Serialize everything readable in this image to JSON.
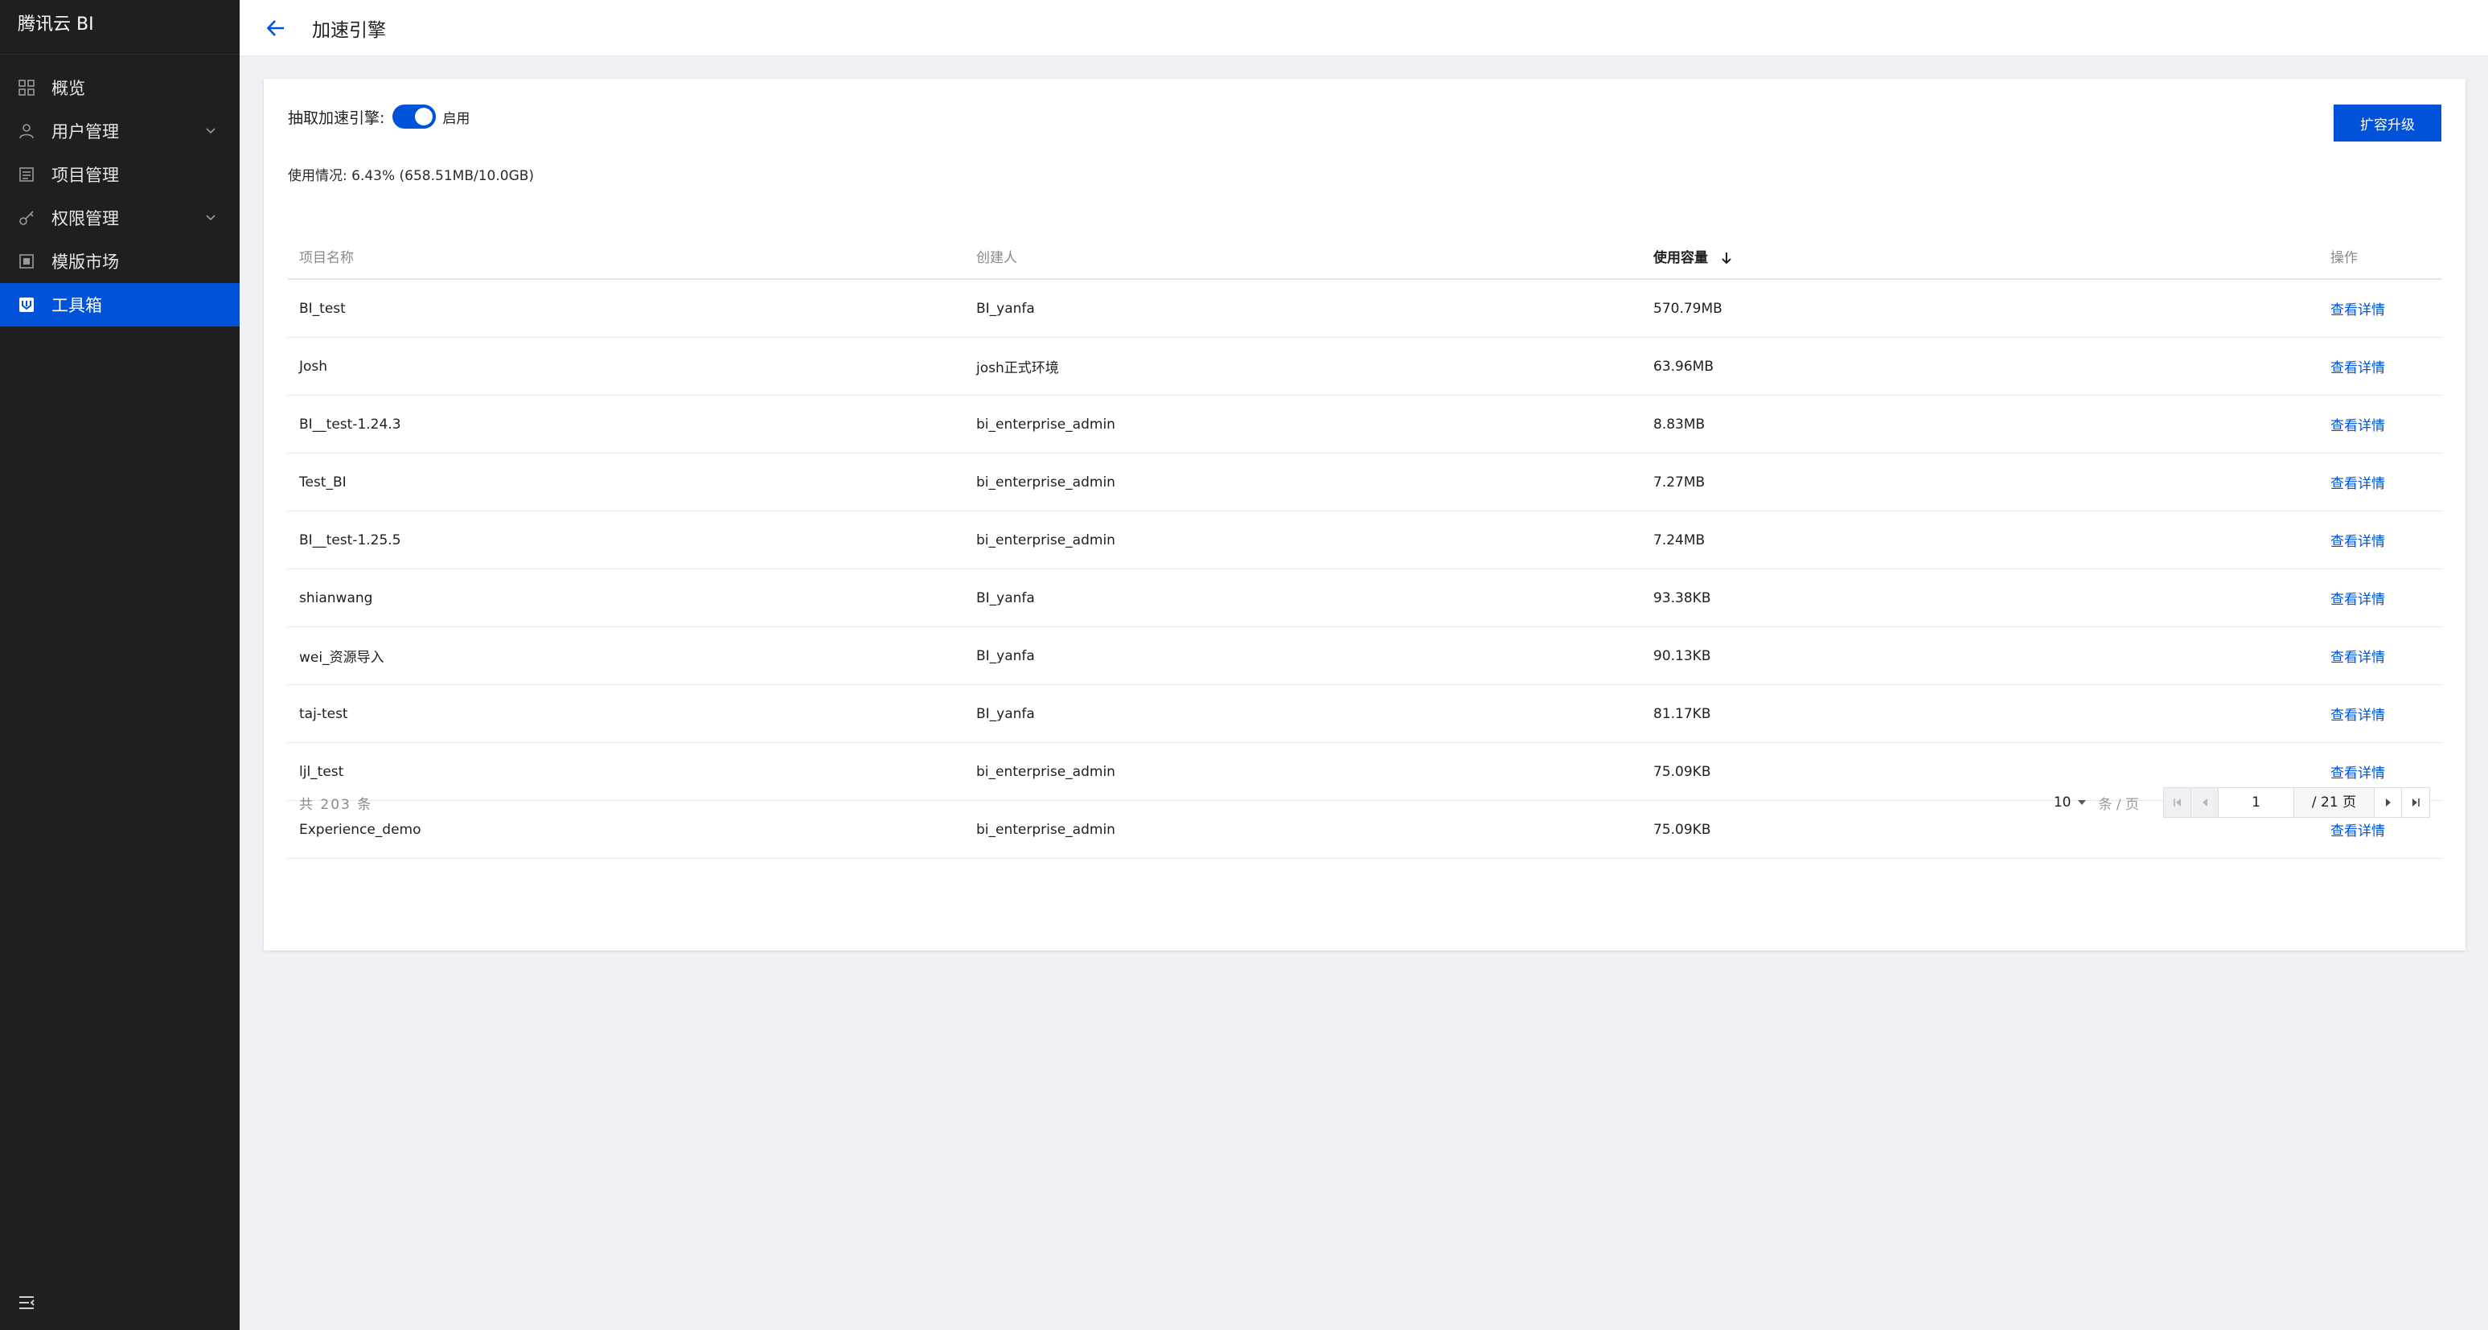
{
  "app": {
    "brand": "腾讯云 BI"
  },
  "sidebar": {
    "items": [
      {
        "label": "概览",
        "icon": "dashboard-icon",
        "expandable": false,
        "active": false
      },
      {
        "label": "用户管理",
        "icon": "user-icon",
        "expandable": true,
        "active": false
      },
      {
        "label": "项目管理",
        "icon": "project-icon",
        "expandable": false,
        "active": false
      },
      {
        "label": "权限管理",
        "icon": "key-icon",
        "expandable": true,
        "active": false
      },
      {
        "label": "模版市场",
        "icon": "template-icon",
        "expandable": false,
        "active": false
      },
      {
        "label": "工具箱",
        "icon": "toolbox-icon",
        "expandable": false,
        "active": true
      }
    ]
  },
  "header": {
    "title": "加速引擎"
  },
  "engine": {
    "label": "抽取加速引擎:",
    "toggle_on": true,
    "toggle_label": "启用",
    "usage_text": "使用情况: 6.43% (658.51MB/10.0GB)",
    "upgrade_button": "扩容升级"
  },
  "table": {
    "columns": [
      "项目名称",
      "创建人",
      "使用容量",
      "操作"
    ],
    "sorted_column": "使用容量",
    "rows": [
      {
        "name": "BI_test",
        "creator": "BI_yanfa",
        "usage": "570.79MB",
        "action": "查看详情"
      },
      {
        "name": "Josh",
        "creator": "josh正式环境",
        "usage": "63.96MB",
        "action": "查看详情"
      },
      {
        "name": "BI__test-1.24.3",
        "creator": "bi_enterprise_admin",
        "usage": "8.83MB",
        "action": "查看详情"
      },
      {
        "name": "Test_BI",
        "creator": "bi_enterprise_admin",
        "usage": "7.27MB",
        "action": "查看详情"
      },
      {
        "name": "BI__test-1.25.5",
        "creator": "bi_enterprise_admin",
        "usage": "7.24MB",
        "action": "查看详情"
      },
      {
        "name": "shianwang",
        "creator": "BI_yanfa",
        "usage": "93.38KB",
        "action": "查看详情"
      },
      {
        "name": "wei_资源导入",
        "creator": "BI_yanfa",
        "usage": "90.13KB",
        "action": "查看详情"
      },
      {
        "name": "taj-test",
        "creator": "BI_yanfa",
        "usage": "81.17KB",
        "action": "查看详情"
      },
      {
        "name": "ljl_test",
        "creator": "bi_enterprise_admin",
        "usage": "75.09KB",
        "action": "查看详情"
      },
      {
        "name": "Experience_demo",
        "creator": "bi_enterprise_admin",
        "usage": "75.09KB",
        "action": "查看详情"
      }
    ]
  },
  "pagination": {
    "total_text": "共 203 条",
    "page_size": "10",
    "per_page_label": "条 / 页",
    "current_page": "1",
    "total_pages_text": "/ 21 页"
  },
  "colors": {
    "accent": "#0052d9",
    "sidebar_bg": "#1f1f1f",
    "page_bg": "#f0f1f5"
  }
}
